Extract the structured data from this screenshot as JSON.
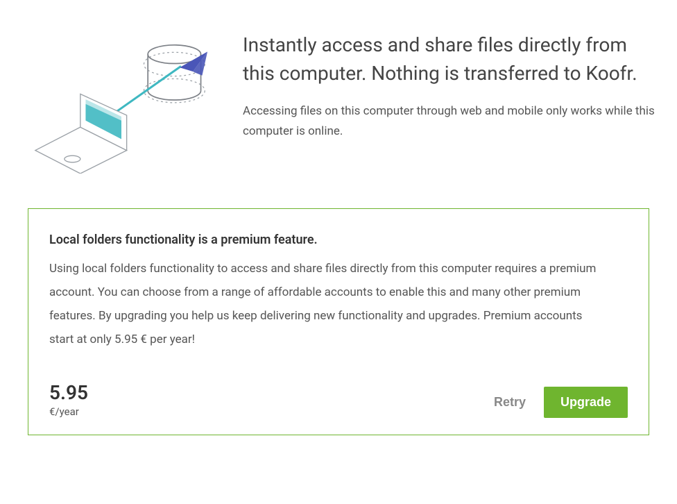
{
  "hero": {
    "title": "Instantly access and share files directly from this computer. Nothing is transferred to Koofr.",
    "subtitle": "Accessing files on this computer through web and mobile only works while this computer is online."
  },
  "premium": {
    "heading": "Local folders functionality is a premium feature.",
    "body": "Using local folders functionality to access and share files directly from this computer requires a premium account. You can choose from a range of affordable accounts to enable this and many other premium features. By upgrading you help us keep delivering new functionality and upgrades. Premium accounts start at only 5.95 € per year!",
    "price_amount": "5.95",
    "price_unit": "€/year",
    "retry_label": "Retry",
    "upgrade_label": "Upgrade"
  },
  "colors": {
    "accent": "#6fb52f",
    "teal": "#3fb8c1",
    "indigo": "#4a56b8"
  }
}
